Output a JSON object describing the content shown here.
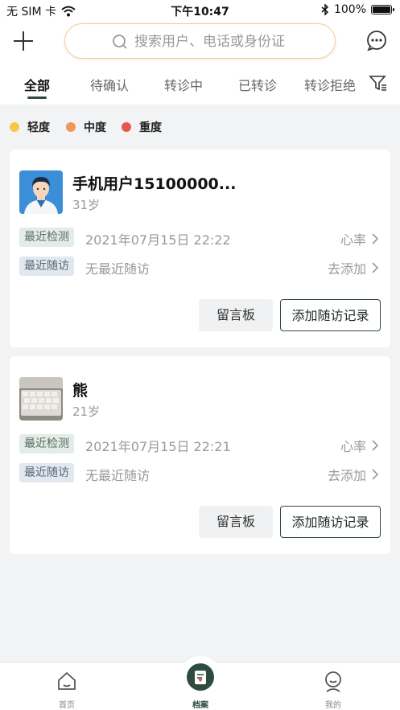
{
  "status_bar": {
    "carrier": "无 SIM 卡",
    "time": "下午10:47",
    "battery": "100%"
  },
  "header": {
    "search_placeholder": "搜索用户、电话或身份证"
  },
  "tabs": [
    {
      "label": "全部",
      "active": true
    },
    {
      "label": "待确认",
      "active": false
    },
    {
      "label": "转诊中",
      "active": false
    },
    {
      "label": "已转诊",
      "active": false
    },
    {
      "label": "转诊拒绝",
      "active": false
    }
  ],
  "legend": [
    {
      "label": "轻度",
      "color": "#f2c94c"
    },
    {
      "label": "中度",
      "color": "#f0965a"
    },
    {
      "label": "重度",
      "color": "#e05a4f"
    }
  ],
  "patients": [
    {
      "name": "手机用户15100000...",
      "age": "31岁",
      "detect_tag": "最近检测",
      "detect_value": "2021年07月15日 22:22",
      "detect_link": "心率",
      "visit_tag": "最近随访",
      "visit_value": "无最近随访",
      "visit_link": "去添加",
      "message_btn": "留言板",
      "add_btn": "添加随访记录"
    },
    {
      "name": "熊",
      "age": "21岁",
      "detect_tag": "最近检测",
      "detect_value": "2021年07月15日 22:21",
      "detect_link": "心率",
      "visit_tag": "最近随访",
      "visit_value": "无最近随访",
      "visit_link": "去添加",
      "message_btn": "留言板",
      "add_btn": "添加随访记录"
    }
  ],
  "bottom_nav": [
    {
      "label": "首页",
      "icon": "home-icon",
      "active": false
    },
    {
      "label": "档案",
      "icon": "archive-icon",
      "active": true
    },
    {
      "label": "我的",
      "icon": "profile-icon",
      "active": false
    }
  ],
  "colors": {
    "accent": "#2e4b3f",
    "search_border": "#f0c9a0"
  }
}
